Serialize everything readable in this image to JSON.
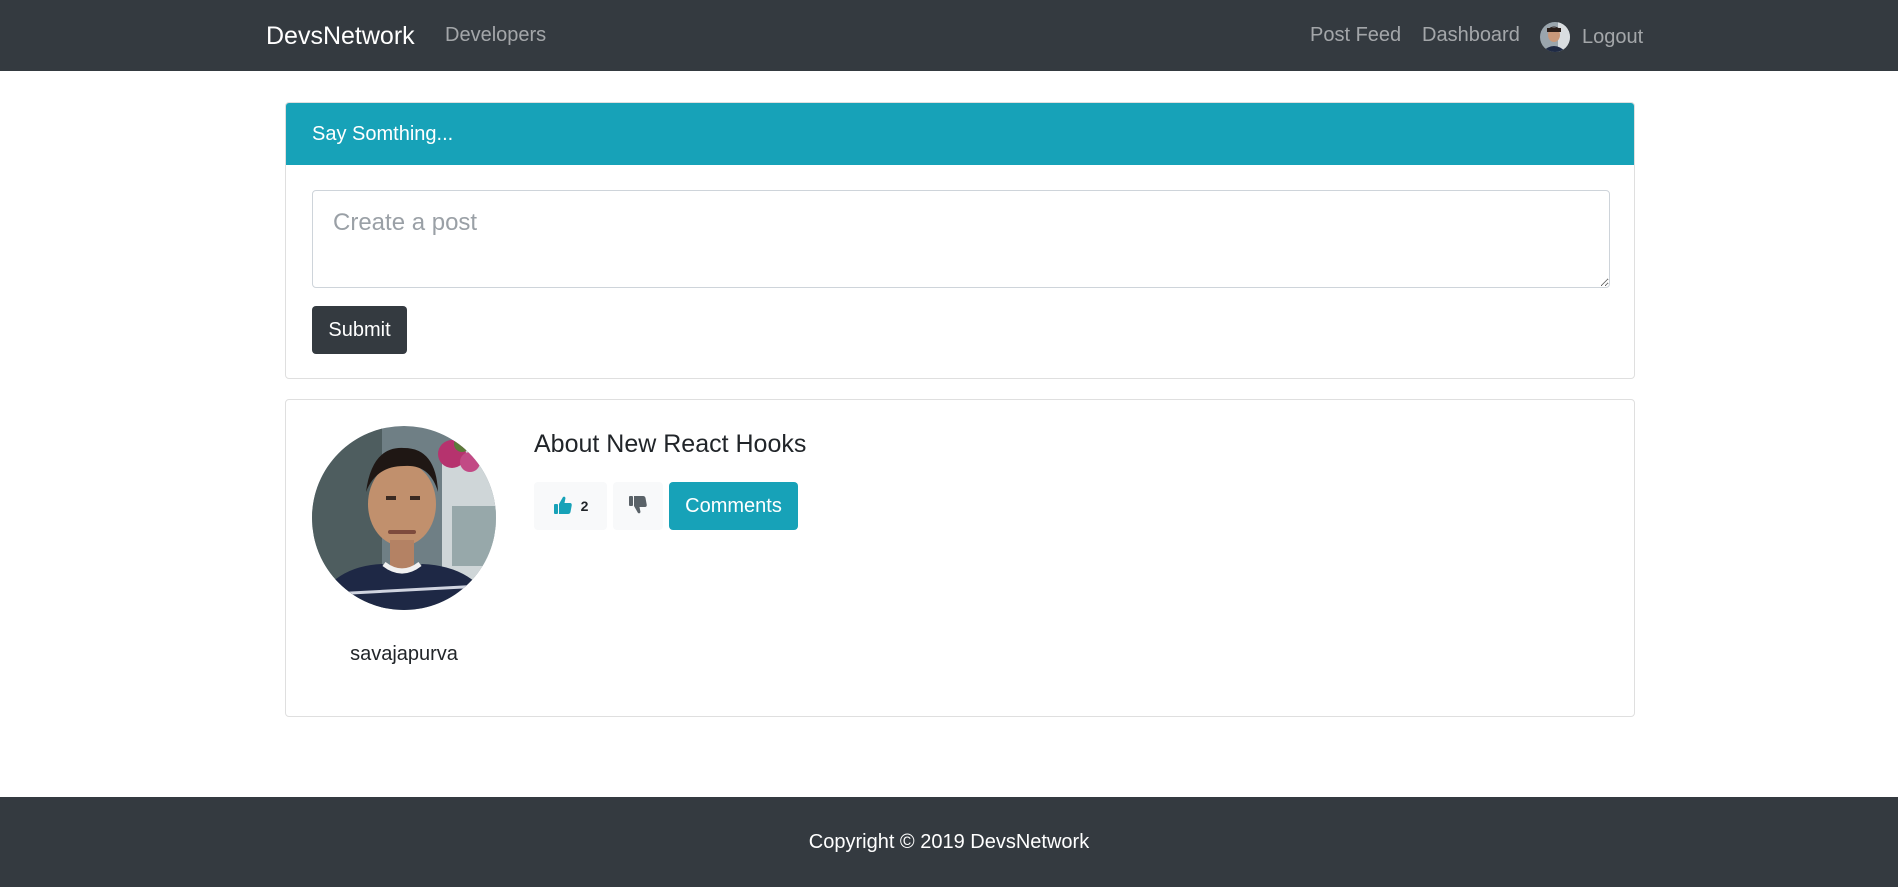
{
  "navbar": {
    "brand": "DevsNetwork",
    "developers": "Developers",
    "post_feed": "Post Feed",
    "dashboard": "Dashboard",
    "logout": "Logout"
  },
  "post_form": {
    "header": "Say Somthing...",
    "placeholder": "Create a post",
    "value": "",
    "submit_label": "Submit"
  },
  "posts": [
    {
      "author": "savajapurva",
      "text": "About New React Hooks",
      "likes": "2",
      "comments_label": "Comments"
    }
  ],
  "footer": {
    "copyright": "Copyright © 2019 DevsNetwork"
  },
  "colors": {
    "navbar_bg": "#343a40",
    "info": "#17a2b8",
    "light": "#f8f9fa"
  },
  "icons": [
    "thumbs-up-icon",
    "thumbs-down-icon"
  ]
}
